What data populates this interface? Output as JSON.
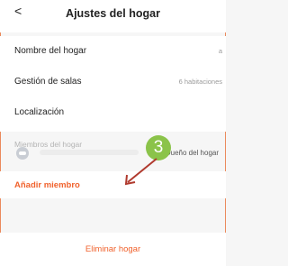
{
  "header": {
    "back_icon": "chevron-left-icon",
    "back_glyph": "<",
    "title": "Ajustes del hogar"
  },
  "settings": {
    "home_name": {
      "label": "Nombre del hogar",
      "value": "a"
    },
    "rooms": {
      "label": "Gestión de salas",
      "value": "6 habitaciones"
    },
    "location": {
      "label": "Localización"
    }
  },
  "members": {
    "section_label": "Miembros del hogar",
    "owner_role": "Dueño del hogar",
    "add_label": "Añadir miembro"
  },
  "annotation": {
    "step_number": "3",
    "badge_color": "#8bc34a",
    "arrow_color": "#b03a2e"
  },
  "footer": {
    "delete_label": "Eliminar hogar"
  },
  "colors": {
    "accent": "#f0622d",
    "background": "#f6f6f6"
  }
}
